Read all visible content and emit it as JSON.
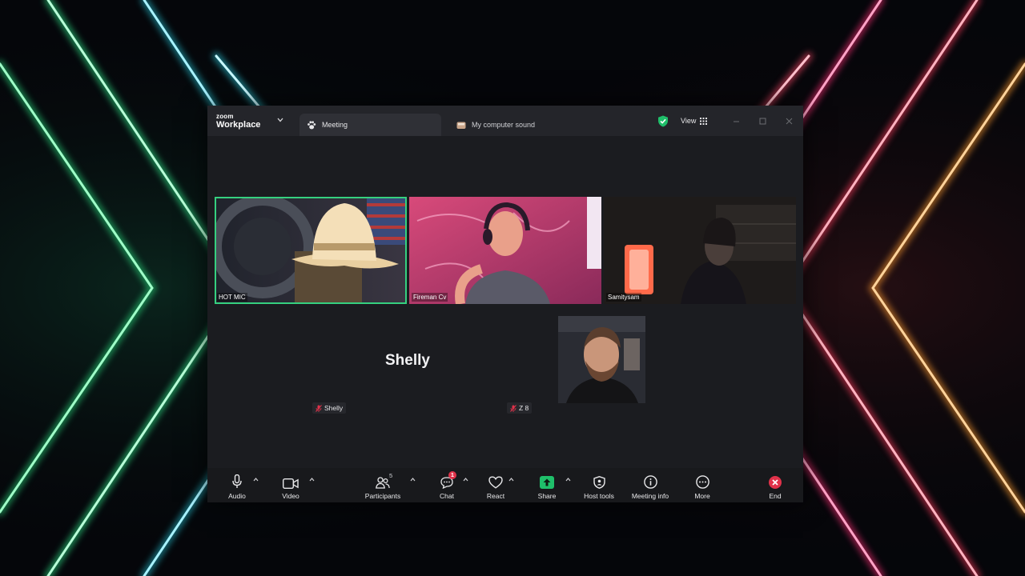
{
  "window": {
    "brand_top": "zoom",
    "brand_name": "Workplace",
    "tabs": [
      {
        "label": "Meeting",
        "icon": "paw-icon",
        "active": true
      },
      {
        "label": "My computer sound",
        "icon": "audio-app-icon",
        "active": false
      }
    ],
    "view_label": "View"
  },
  "participants": [
    {
      "name": "HOT MIC",
      "active_speaker": true
    },
    {
      "name": "Fireman Cv"
    },
    {
      "name": "Samitysam"
    },
    {
      "name": "Shelly",
      "video": false,
      "muted": true
    },
    {
      "name": "Z 8",
      "muted": true
    }
  ],
  "toolbar": {
    "audio": "Audio",
    "video": "Video",
    "participants": "Participants",
    "participants_count": "5",
    "chat": "Chat",
    "chat_badge": "1",
    "react": "React",
    "share": "Share",
    "host_tools": "Host tools",
    "meeting_info": "Meeting info",
    "more": "More",
    "end": "End"
  },
  "colors": {
    "active_speaker": "#35d07f",
    "share": "#1fbf6a",
    "end": "#e0324a",
    "shield": "#1fbf6a"
  }
}
